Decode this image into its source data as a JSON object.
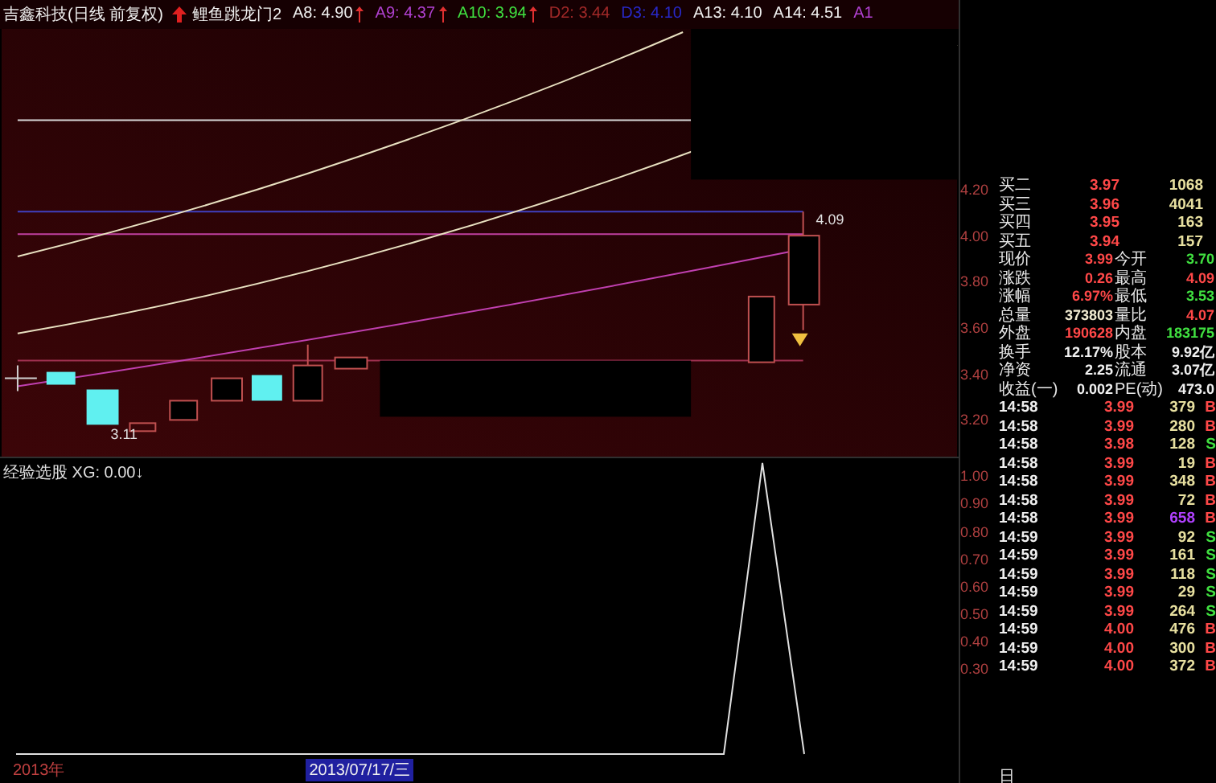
{
  "header": {
    "title": "吉鑫科技(日线 前复权)",
    "indicator": "鲤鱼跳龙门2",
    "values": [
      {
        "text": "A8: 4.90",
        "color": "#f0f0f0",
        "up_arrow": true
      },
      {
        "text": "A9: 4.37",
        "color": "#b040d0",
        "up_arrow": true
      },
      {
        "text": "A10: 3.94",
        "color": "#40e040",
        "up_arrow": true
      },
      {
        "text": "D2: 3.44",
        "color": "#a02828",
        "up_arrow": false
      },
      {
        "text": "D3: 4.10",
        "color": "#2828c8",
        "up_arrow": false
      },
      {
        "text": "A13: 4.10",
        "color": "#f0f0f0",
        "up_arrow": false
      },
      {
        "text": "A14: 4.51",
        "color": "#f0f0f0",
        "up_arrow": false
      },
      {
        "text": "A1",
        "color": "#b040d0",
        "up_arrow": false
      }
    ]
  },
  "chart_labels": {
    "high": "4.09",
    "low": "3.11"
  },
  "sub_panel": {
    "label": "经验选股 XG: 0.00↓"
  },
  "price_axis": [
    "4.20",
    "4.00",
    "3.80",
    "3.60",
    "3.40",
    "3.20"
  ],
  "sub_axis": [
    "1.00",
    "0.90",
    "0.80",
    "0.70",
    "0.60",
    "0.50",
    "0.40",
    "0.30"
  ],
  "quotes": [
    {
      "label": "买二",
      "price": "3.97",
      "volume": "1068"
    },
    {
      "label": "买三",
      "price": "3.96",
      "volume": "4041"
    },
    {
      "label": "买四",
      "price": "3.95",
      "volume": "163"
    },
    {
      "label": "买五",
      "price": "3.94",
      "volume": "157"
    }
  ],
  "stats": [
    [
      {
        "label": "现价",
        "value": "3.99",
        "color": "#ff4848"
      },
      {
        "label": "今开",
        "value": "3.70",
        "color": "#40e040"
      }
    ],
    [
      {
        "label": "涨跌",
        "value": "0.26",
        "color": "#ff4848"
      },
      {
        "label": "最高",
        "value": "4.09",
        "color": "#ff4848"
      }
    ],
    [
      {
        "label": "涨幅",
        "value": "6.97%",
        "color": "#ff4848"
      },
      {
        "label": "最低",
        "value": "3.53",
        "color": "#40e040"
      }
    ],
    [
      {
        "label": "总量",
        "value": "373803",
        "color": "#f0ead0"
      },
      {
        "label": "量比",
        "value": "4.07",
        "color": "#ff4848"
      }
    ],
    [
      {
        "label": "外盘",
        "value": "190628",
        "color": "#ff4848"
      },
      {
        "label": "内盘",
        "value": "183175",
        "color": "#40e040"
      }
    ],
    [
      {
        "label": "换手",
        "value": "12.17%",
        "color": "#f0f0f0"
      },
      {
        "label": "股本",
        "value": "9.92亿",
        "color": "#f0f0f0"
      }
    ],
    [
      {
        "label": "净资",
        "value": "2.25",
        "color": "#f0f0f0"
      },
      {
        "label": "流通",
        "value": "3.07亿",
        "color": "#f0f0f0"
      }
    ],
    [
      {
        "label": "收益(一)",
        "value": "0.002",
        "color": "#f0f0f0"
      },
      {
        "label": "PE(动)",
        "value": "473.0",
        "color": "#f0f0f0"
      }
    ]
  ],
  "ticks": [
    {
      "time": "14:58",
      "price": "3.99",
      "volume": {
        "text": "379",
        "color": "#e8e0a0"
      },
      "side": {
        "text": "B",
        "color": "#ff4848"
      }
    },
    {
      "time": "14:58",
      "price": "3.99",
      "volume": {
        "text": "280",
        "color": "#e8e0a0"
      },
      "side": {
        "text": "B",
        "color": "#ff4848"
      }
    },
    {
      "time": "14:58",
      "price": "3.98",
      "volume": {
        "text": "128",
        "color": "#e8e0a0"
      },
      "side": {
        "text": "S",
        "color": "#40e040"
      }
    },
    {
      "time": "14:58",
      "price": "3.99",
      "volume": {
        "text": "19",
        "color": "#e8e0a0"
      },
      "side": {
        "text": "B",
        "color": "#ff4848"
      }
    },
    {
      "time": "14:58",
      "price": "3.99",
      "volume": {
        "text": "348",
        "color": "#e8e0a0"
      },
      "side": {
        "text": "B",
        "color": "#ff4848"
      }
    },
    {
      "time": "14:58",
      "price": "3.99",
      "volume": {
        "text": "72",
        "color": "#e8e0a0"
      },
      "side": {
        "text": "B",
        "color": "#ff4848"
      }
    },
    {
      "time": "14:58",
      "price": "3.99",
      "volume": {
        "text": "658",
        "color": "#b040ff"
      },
      "side": {
        "text": "B",
        "color": "#ff4848"
      }
    },
    {
      "time": "14:59",
      "price": "3.99",
      "volume": {
        "text": "92",
        "color": "#e8e0a0"
      },
      "side": {
        "text": "S",
        "color": "#40e040"
      }
    },
    {
      "time": "14:59",
      "price": "3.99",
      "volume": {
        "text": "161",
        "color": "#e8e0a0"
      },
      "side": {
        "text": "S",
        "color": "#40e040"
      }
    },
    {
      "time": "14:59",
      "price": "3.99",
      "volume": {
        "text": "118",
        "color": "#e8e0a0"
      },
      "side": {
        "text": "S",
        "color": "#40e040"
      }
    },
    {
      "time": "14:59",
      "price": "3.99",
      "volume": {
        "text": "29",
        "color": "#e8e0a0"
      },
      "side": {
        "text": "S",
        "color": "#40e040"
      }
    },
    {
      "time": "14:59",
      "price": "3.99",
      "volume": {
        "text": "264",
        "color": "#e8e0a0"
      },
      "side": {
        "text": "S",
        "color": "#40e040"
      }
    },
    {
      "time": "14:59",
      "price": "4.00",
      "volume": {
        "text": "476",
        "color": "#e8e0a0"
      },
      "side": {
        "text": "B",
        "color": "#ff4848"
      }
    },
    {
      "time": "14:59",
      "price": "4.00",
      "volume": {
        "text": "300",
        "color": "#e8e0a0"
      },
      "side": {
        "text": "B",
        "color": "#ff4848"
      }
    },
    {
      "time": "14:59",
      "price": "4.00",
      "volume": {
        "text": "372",
        "color": "#e8e0a0"
      },
      "side": {
        "text": "B",
        "color": "#ff4848"
      }
    }
  ],
  "time_axis": [
    {
      "text": "2013年",
      "selected": false
    },
    {
      "text": "2013/07/17/三",
      "selected": true
    }
  ],
  "corner_label": "日"
}
